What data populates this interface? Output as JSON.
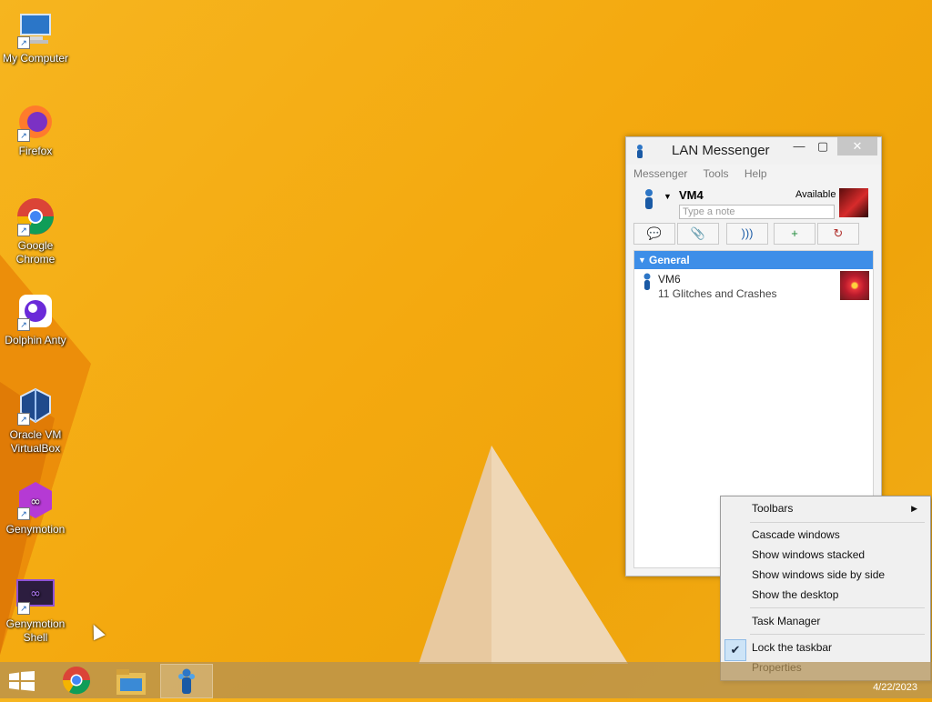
{
  "desktop": {
    "icons": [
      {
        "label": "My Computer",
        "icon": "computer-icon"
      },
      {
        "label": "Firefox",
        "icon": "firefox-icon"
      },
      {
        "label": "Google Chrome",
        "icon": "chrome-icon"
      },
      {
        "label": "Dolphin Anty",
        "icon": "dolphin-anty-icon"
      },
      {
        "label": "Oracle VM VirtualBox",
        "icon": "virtualbox-icon"
      },
      {
        "label": "Genymotion",
        "icon": "genymotion-icon"
      },
      {
        "label": "Genymotion Shell",
        "icon": "genymotion-shell-icon"
      }
    ]
  },
  "window": {
    "title": "LAN Messenger",
    "menu": [
      "Messenger",
      "Tools",
      "Help"
    ],
    "user": {
      "name": "VM4",
      "status": "Available",
      "note_placeholder": "Type a note"
    },
    "group": {
      "name": "General"
    },
    "contacts": [
      {
        "name": "VM6",
        "note": "11 Glitches and Crashes"
      }
    ]
  },
  "context_menu": {
    "items": [
      {
        "label": "Toolbars"
      },
      {
        "label": "Cascade windows"
      },
      {
        "label": "Show windows stacked"
      },
      {
        "label": "Show windows side by side"
      },
      {
        "label": "Show the desktop"
      },
      {
        "label": "Task Manager"
      },
      {
        "label": "Lock the taskbar",
        "checked": true
      },
      {
        "label": "Properties"
      }
    ]
  },
  "taskbar": {
    "date": "4/22/2023",
    "apps": [
      "start-icon",
      "chrome-icon",
      "file-explorer-icon",
      "lan-messenger-icon"
    ]
  }
}
